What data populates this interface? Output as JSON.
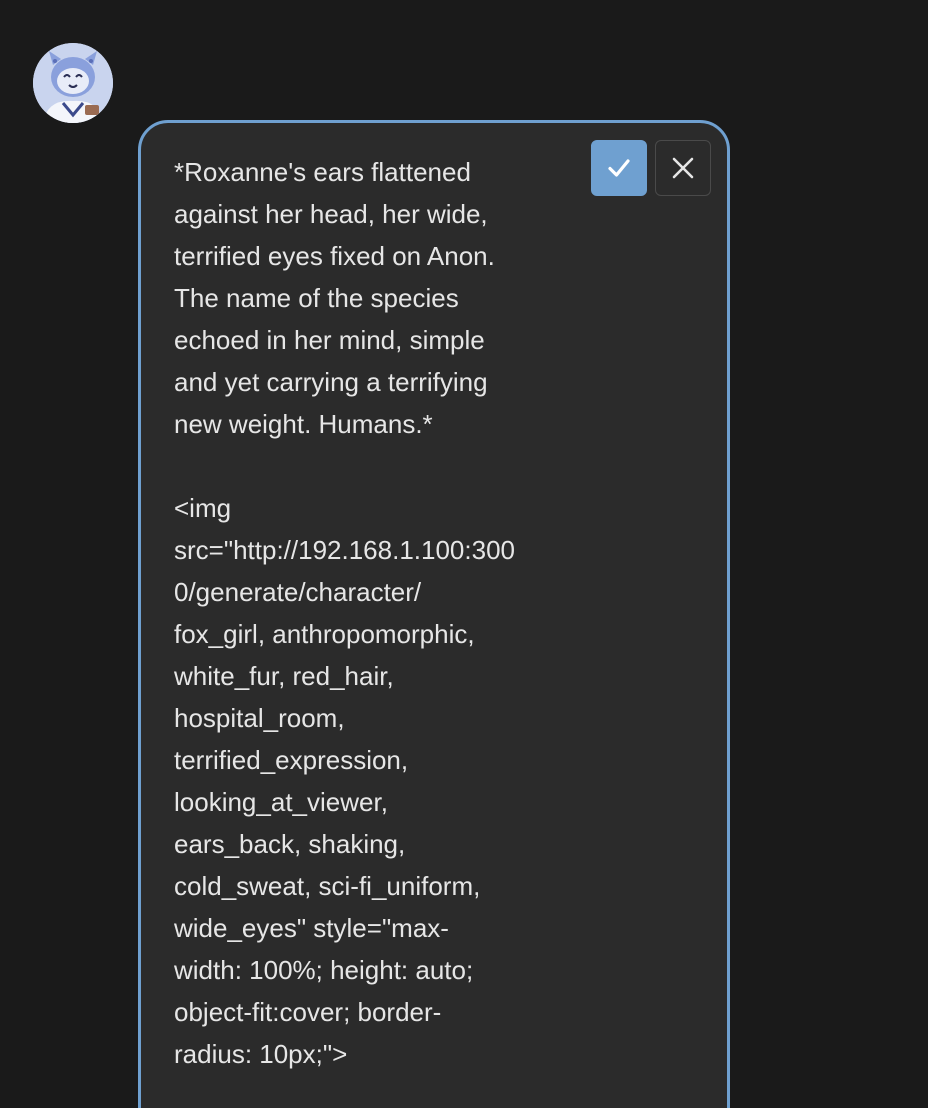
{
  "avatar": {
    "icon": "character-avatar"
  },
  "editor": {
    "text_lines": [
      "*Roxanne's ears flattened",
      "against her head, her wide,",
      "terrified eyes fixed on Anon.",
      "The name of the species",
      "echoed in her mind, simple",
      "and yet carrying a terrifying",
      "new weight. Humans.*",
      "",
      "<img",
      "src=\"http://192.168.1.100:300",
      "0/generate/character/",
      "fox_girl, anthropomorphic,",
      "white_fur, red_hair,",
      "hospital_room,",
      "terrified_expression,",
      "looking_at_viewer,",
      "ears_back, shaking,",
      "cold_sweat, sci-fi_uniform,",
      "wide_eyes\" style=\"max-",
      "width: 100%; height: auto;",
      "object-fit:cover; border-",
      "radius: 10px;\">"
    ],
    "confirm_icon": "check-icon",
    "cancel_icon": "close-icon"
  },
  "colors": {
    "background": "#1a1a1a",
    "editor_background": "#2b2b2b",
    "accent": "#6fa0d0",
    "text": "#e6e6e6"
  }
}
